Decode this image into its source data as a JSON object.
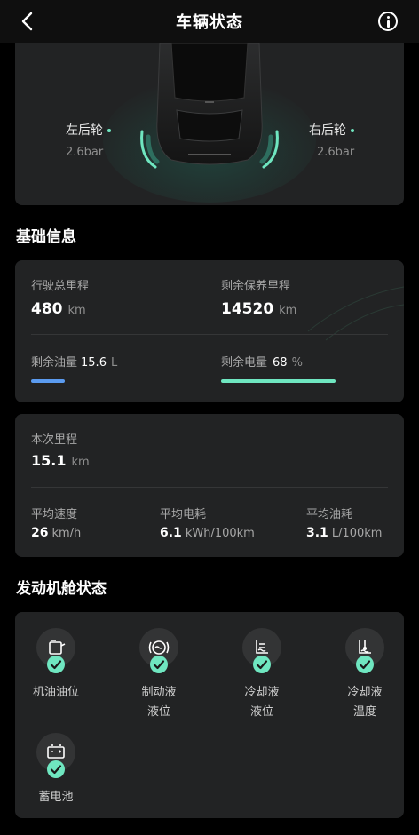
{
  "header": {
    "title": "车辆状态"
  },
  "tires": {
    "left_rear_label": "左后轮",
    "left_rear_value": "2.6bar",
    "right_rear_label": "右后轮",
    "right_rear_value": "2.6bar"
  },
  "basic": {
    "section_title": "基础信息",
    "total_mileage_label": "行驶总里程",
    "total_mileage_value": "480",
    "total_mileage_unit": "km",
    "maintenance_label": "剩余保养里程",
    "maintenance_value": "14520",
    "maintenance_unit": "km",
    "fuel_label": "剩余油量",
    "fuel_value": "15.6",
    "fuel_unit": "L",
    "fuel_fill_fraction": 0.2,
    "battery_label": "剩余电量",
    "battery_value": "68",
    "battery_unit": "%",
    "battery_fill_fraction": 0.68
  },
  "trip": {
    "mileage_label": "本次里程",
    "mileage_value": "15.1",
    "mileage_unit": "km",
    "avg_speed_label": "平均速度",
    "avg_speed_value": "26",
    "avg_speed_unit": "km/h",
    "avg_power_label": "平均电耗",
    "avg_power_value": "6.1",
    "avg_power_unit": "kWh/100km",
    "avg_fuel_label": "平均油耗",
    "avg_fuel_value": "3.1",
    "avg_fuel_unit": "L/100km"
  },
  "engine": {
    "section_title": "发动机舱状态",
    "items": [
      {
        "line1": "机油油位",
        "line2": "",
        "icon": "oil-can-icon",
        "status": "ok"
      },
      {
        "line1": "制动液",
        "line2": "液位",
        "icon": "brake-fluid-icon",
        "status": "ok"
      },
      {
        "line1": "冷却液",
        "line2": "液位",
        "icon": "coolant-level-icon",
        "status": "ok"
      },
      {
        "line1": "冷却液",
        "line2": "温度",
        "icon": "coolant-temp-icon",
        "status": "ok"
      },
      {
        "line1": "蓄电池",
        "line2": "",
        "icon": "battery-icon",
        "status": "ok"
      }
    ]
  },
  "colors": {
    "accent": "#6fe6c0",
    "fuel_bar": "#5b9bf0",
    "card_bg": "#222324",
    "page_bg": "#000000"
  }
}
